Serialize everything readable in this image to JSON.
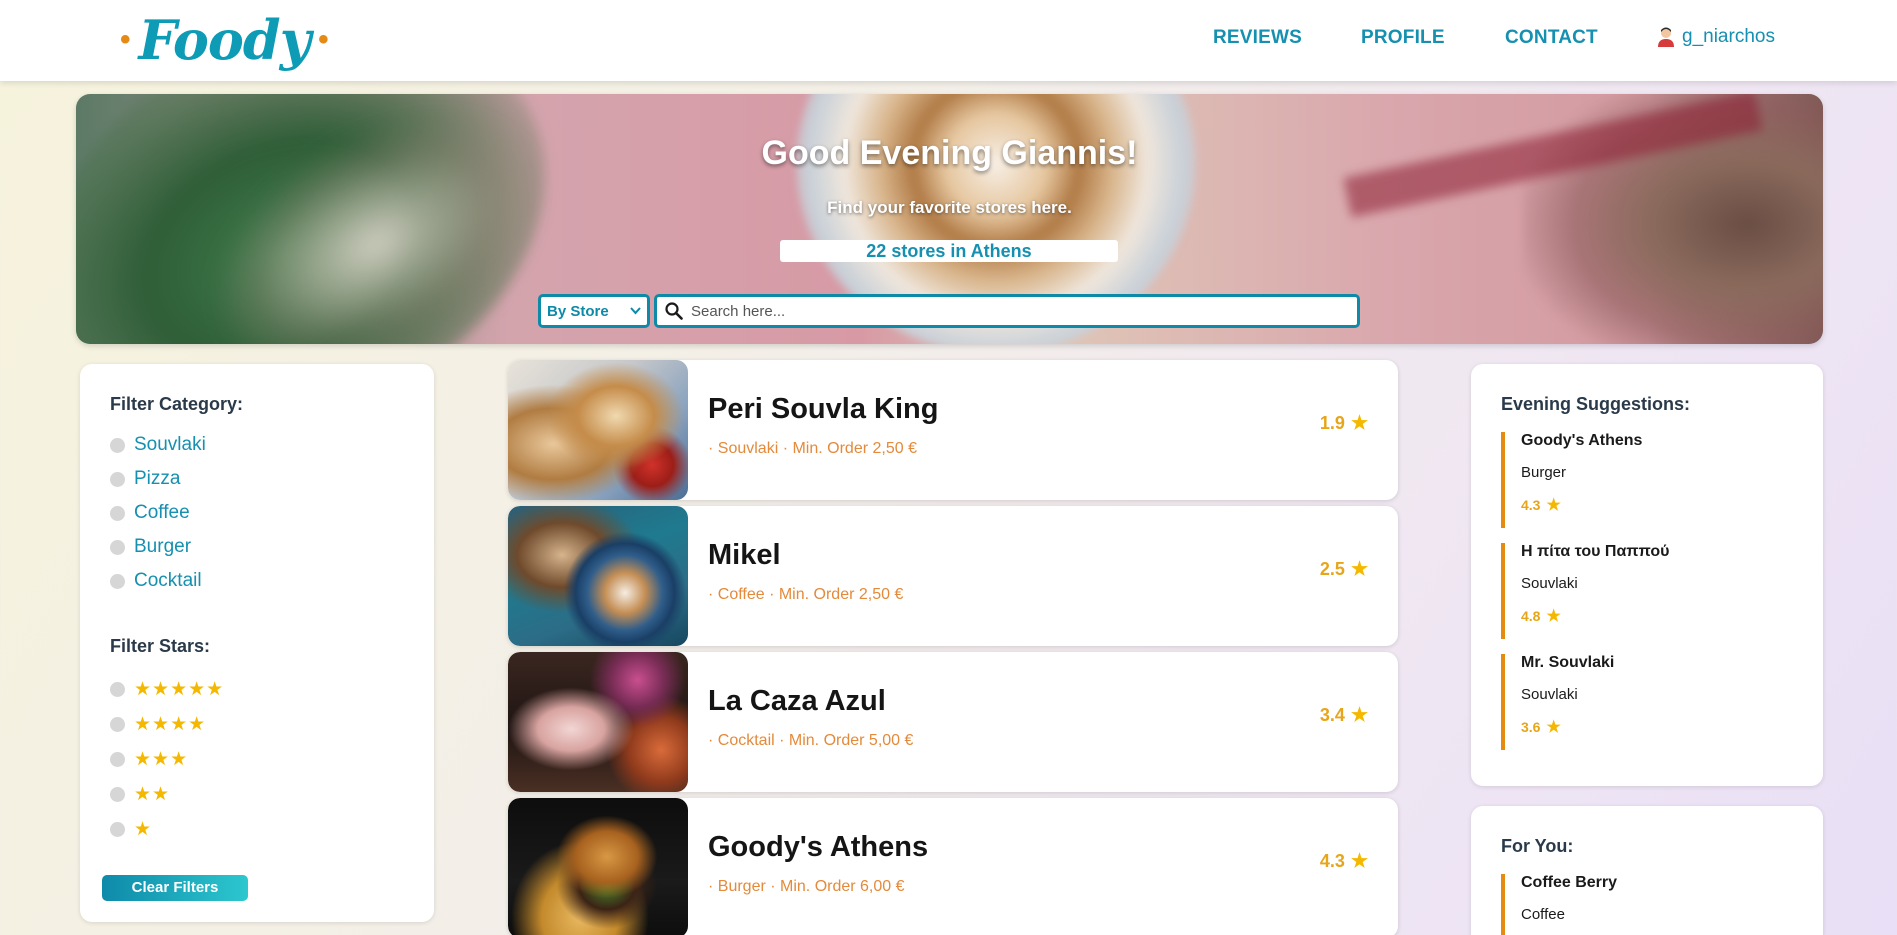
{
  "navbar": {
    "logo_text": "Foody",
    "logo_dot_left": "•",
    "logo_dot_right": "•",
    "links": [
      {
        "label": "REVIEWS"
      },
      {
        "label": "PROFILE"
      },
      {
        "label": "CONTACT"
      }
    ],
    "user": {
      "name": "g_niarchos",
      "icon": "user-avatar-icon"
    }
  },
  "hero": {
    "greeting": "Good Evening Giannis!",
    "subtitle": "Find your favorite stores here.",
    "store_count": "22 stores in Athens",
    "search": {
      "mode_selected": "By Store",
      "placeholder": "Search here...",
      "value": ""
    }
  },
  "filters": {
    "category_heading": "Filter Category:",
    "categories": [
      "Souvlaki",
      "Pizza",
      "Coffee",
      "Burger",
      "Cocktail"
    ],
    "stars_heading": "Filter Stars:",
    "star_options": [
      5,
      4,
      3,
      2,
      1
    ],
    "clear_label": "Clear Filters"
  },
  "stores": [
    {
      "name": "Peri Souvla King",
      "meta": "· Souvlaki · Min. Order 2,50 €",
      "rating": "1.9",
      "image": "souvlaki-photo"
    },
    {
      "name": "Mikel",
      "meta": "· Coffee · Min. Order 2,50 €",
      "rating": "2.5",
      "image": "coffee-photo"
    },
    {
      "name": "La Caza Azul",
      "meta": "· Cocktail · Min. Order 5,00 €",
      "rating": "3.4",
      "image": "cocktail-photo"
    },
    {
      "name": "Goody's Athens",
      "meta": "· Burger · Min. Order 6,00 €",
      "rating": "4.3",
      "image": "burger-photo"
    }
  ],
  "suggestions": {
    "heading": "Evening Suggestions:",
    "items": [
      {
        "name": "Goody's Athens",
        "category": "Burger",
        "rating": "4.3"
      },
      {
        "name": "Η πίτα του Παππού",
        "category": "Souvlaki",
        "rating": "4.8"
      },
      {
        "name": "Mr. Souvlaki",
        "category": "Souvlaki",
        "rating": "3.6"
      }
    ]
  },
  "for_you": {
    "heading": "For You:",
    "items": [
      {
        "name": "Coffee Berry",
        "category": "Coffee"
      }
    ]
  },
  "colors": {
    "brand": "#1690b0",
    "accent": "#e58a12",
    "star": "#f5b800",
    "meta_text": "#e48a3a"
  }
}
